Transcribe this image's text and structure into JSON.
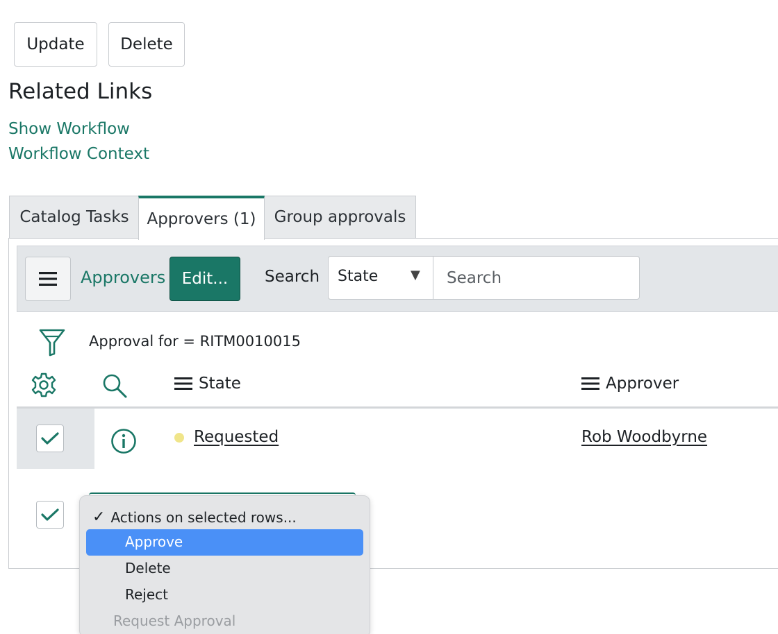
{
  "form_buttons": {
    "update": "Update",
    "delete": "Delete"
  },
  "related_links": {
    "title": "Related Links",
    "items": [
      "Show Workflow",
      "Workflow Context"
    ]
  },
  "tabs": [
    {
      "label": "Catalog Tasks",
      "active": false
    },
    {
      "label": "Approvers (1)",
      "active": true
    },
    {
      "label": "Group approvals",
      "active": false
    }
  ],
  "list": {
    "title": "Approvers",
    "edit_label": "Edit...",
    "search_label": "Search",
    "search_field_selected": "State",
    "search_placeholder": "Search",
    "filter": "Approval for = RITM0010015",
    "columns": [
      "State",
      "Approver"
    ],
    "rows": [
      {
        "selected": true,
        "state": "Requested",
        "state_color": "#f0e58a",
        "approver": "Rob Woodbyrne"
      }
    ]
  },
  "actions_menu": {
    "selected": "Actions on selected rows...",
    "items": [
      {
        "label": "Approve",
        "highlighted": true,
        "enabled": true
      },
      {
        "label": "Delete",
        "highlighted": false,
        "enabled": true
      },
      {
        "label": "Reject",
        "highlighted": false,
        "enabled": true
      },
      {
        "label": "Request Approval",
        "highlighted": false,
        "enabled": false
      }
    ]
  },
  "colors": {
    "accent": "#1a7766",
    "menu_highlight": "#4a90f7"
  },
  "icons": [
    "menu-icon",
    "filter-icon",
    "gear-icon",
    "search-icon",
    "info-icon",
    "checkmark-icon",
    "dropdown-arrow-icon"
  ]
}
